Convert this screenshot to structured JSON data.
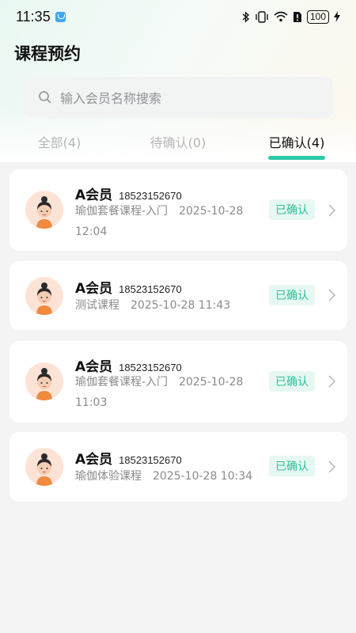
{
  "status_bar": {
    "time": "11:35",
    "battery": "100"
  },
  "page_title": "课程预约",
  "search": {
    "placeholder": "输入会员名称搜索"
  },
  "tabs": [
    {
      "label": "全部(4)",
      "active": false
    },
    {
      "label": "待确认(0)",
      "active": false
    },
    {
      "label": "已确认(4)",
      "active": true
    }
  ],
  "bookings": [
    {
      "name": "A会员",
      "phone": "18523152670",
      "course": "瑜伽套餐课程-入门",
      "datetime": "2025-10-28 12:04",
      "status": "已确认"
    },
    {
      "name": "A会员",
      "phone": "18523152670",
      "course": "测试课程",
      "datetime": "2025-10-28 11:43",
      "status": "已确认"
    },
    {
      "name": "A会员",
      "phone": "18523152670",
      "course": "瑜伽套餐课程-入门",
      "datetime": "2025-10-28 11:03",
      "status": "已确认"
    },
    {
      "name": "A会员",
      "phone": "18523152670",
      "course": "瑜伽体验课程",
      "datetime": "2025-10-28 10:34",
      "status": "已确认"
    }
  ],
  "colors": {
    "accent": "#2cc9a7",
    "badge_bg": "#e7f8f3",
    "badge_text": "#2cbf97"
  },
  "icons": {
    "search": "search-icon",
    "chevron": "chevron-right-icon",
    "avatar": "avatar-icon"
  }
}
